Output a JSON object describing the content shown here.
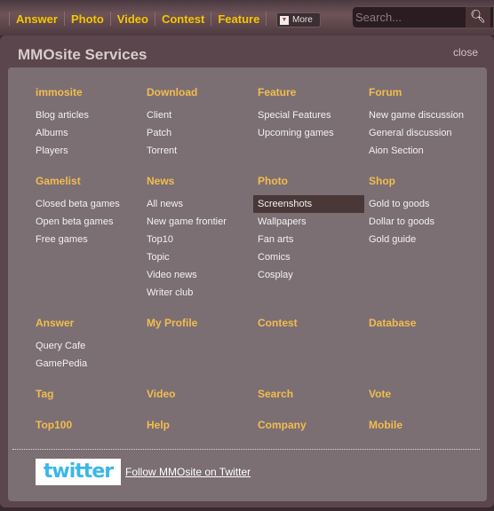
{
  "nav": {
    "items": [
      "Answer",
      "Photo",
      "Video",
      "Contest",
      "Feature"
    ],
    "more_label": "More",
    "search_placeholder": "Search..."
  },
  "panel": {
    "title": "MMOsite Services",
    "close_label": "close"
  },
  "sections": [
    {
      "heading": "immosite",
      "items": [
        "Blog articles",
        "Albums",
        "Players"
      ]
    },
    {
      "heading": "Download",
      "items": [
        "Client",
        "Patch",
        "Torrent"
      ]
    },
    {
      "heading": "Feature",
      "items": [
        "Special Features",
        "Upcoming games"
      ]
    },
    {
      "heading": "Forum",
      "items": [
        "New game discussion",
        "General discussion",
        "Aion Section"
      ]
    },
    {
      "heading": "Gamelist",
      "items": [
        "Closed beta games",
        "Open beta games",
        "Free games"
      ]
    },
    {
      "heading": "News",
      "items": [
        "All news",
        "New game frontier",
        "Top10",
        "Topic",
        "Video news",
        "Writer club"
      ]
    },
    {
      "heading": "Photo",
      "items": [
        "Screenshots",
        "Wallpapers",
        "Fan arts",
        "Comics",
        "Cosplay"
      ],
      "selected": "Screenshots"
    },
    {
      "heading": "Shop",
      "items": [
        "Gold to goods",
        "Dollar to goods",
        "Gold guide"
      ]
    },
    {
      "heading": "Answer",
      "items": [
        "Query Cafe",
        "GamePedia"
      ]
    },
    {
      "heading": "My Profile",
      "items": []
    },
    {
      "heading": "Contest",
      "items": []
    },
    {
      "heading": "Database",
      "items": []
    },
    {
      "heading": "Tag",
      "items": []
    },
    {
      "heading": "Video",
      "items": []
    },
    {
      "heading": "Search",
      "items": []
    },
    {
      "heading": "Vote",
      "items": []
    },
    {
      "heading": "Top100",
      "items": []
    },
    {
      "heading": "Help",
      "items": []
    },
    {
      "heading": "Company",
      "items": []
    },
    {
      "heading": "Mobile",
      "items": []
    }
  ],
  "twitter": {
    "logo_text": "twitter",
    "link": "Follow MMOsite on Twitter"
  }
}
